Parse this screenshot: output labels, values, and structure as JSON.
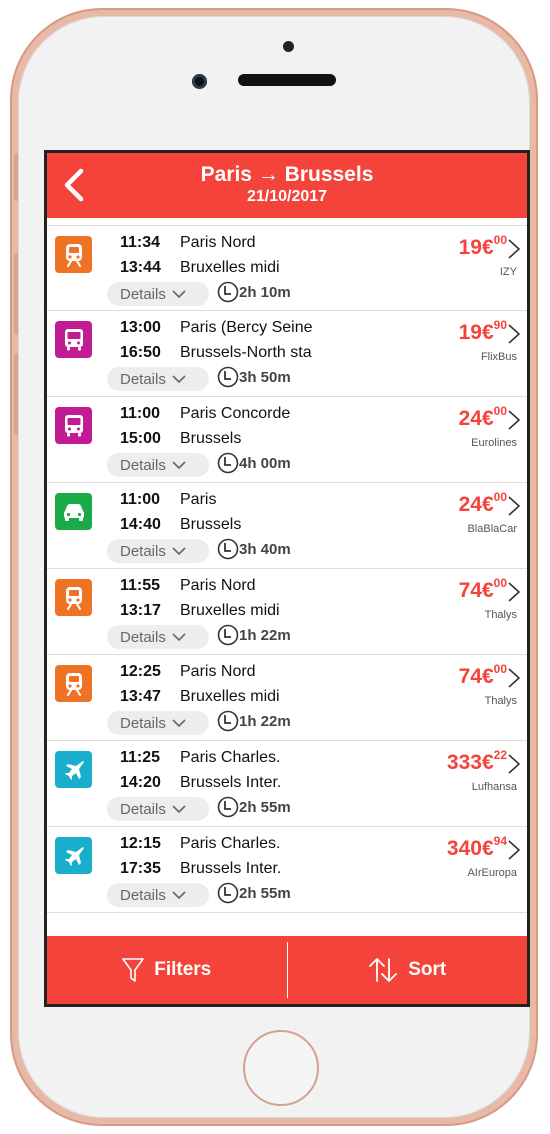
{
  "header": {
    "title": "Paris → Brussels",
    "date": "21/10/2017"
  },
  "colors": {
    "accent": "#f4433a",
    "train": "#f07224",
    "bus": "#c21c94",
    "car": "#1aaa48",
    "plane": "#1aaecd"
  },
  "details_label": "Details",
  "journeys": [
    {
      "mode": "train",
      "dep_time": "11:34",
      "dep_station": "Paris Nord",
      "arr_time": "13:44",
      "arr_station": "Bruxelles midi",
      "duration": "2h 10m",
      "price_main": "19€",
      "price_cents": "00",
      "carrier": "IZY"
    },
    {
      "mode": "bus",
      "dep_time": "13:00",
      "dep_station": "Paris (Bercy Seine",
      "arr_time": "16:50",
      "arr_station": "Brussels-North sta",
      "duration": "3h 50m",
      "price_main": "19€",
      "price_cents": "90",
      "carrier": "FlixBus"
    },
    {
      "mode": "bus",
      "dep_time": "11:00",
      "dep_station": "Paris Concorde",
      "arr_time": "15:00",
      "arr_station": "Brussels",
      "duration": "4h 00m",
      "price_main": "24€",
      "price_cents": "00",
      "carrier": "Eurolines"
    },
    {
      "mode": "car",
      "dep_time": "11:00",
      "dep_station": "Paris",
      "arr_time": "14:40",
      "arr_station": "Brussels",
      "duration": "3h 40m",
      "price_main": "24€",
      "price_cents": "00",
      "carrier": "BlaBlaCar"
    },
    {
      "mode": "train",
      "dep_time": "11:55",
      "dep_station": "Paris Nord",
      "arr_time": "13:17",
      "arr_station": "Bruxelles midi",
      "duration": "1h 22m",
      "price_main": "74€",
      "price_cents": "00",
      "carrier": "Thalys"
    },
    {
      "mode": "train",
      "dep_time": "12:25",
      "dep_station": "Paris Nord",
      "arr_time": "13:47",
      "arr_station": "Bruxelles midi",
      "duration": "1h 22m",
      "price_main": "74€",
      "price_cents": "00",
      "carrier": "Thalys"
    },
    {
      "mode": "plane",
      "dep_time": "11:25",
      "dep_station": "Paris Charles.",
      "arr_time": "14:20",
      "arr_station": "Brussels Inter.",
      "duration": "2h 55m",
      "price_main": "333€",
      "price_cents": "22",
      "carrier": "Lufhansa"
    },
    {
      "mode": "plane",
      "dep_time": "12:15",
      "dep_station": "Paris Charles.",
      "arr_time": "17:35",
      "arr_station": "Brussels Inter.",
      "duration": "2h 55m",
      "price_main": "340€",
      "price_cents": "94",
      "carrier": "AIrEuropa"
    }
  ],
  "bottom_bar": {
    "filters_label": "Filters",
    "sort_label": "Sort"
  }
}
